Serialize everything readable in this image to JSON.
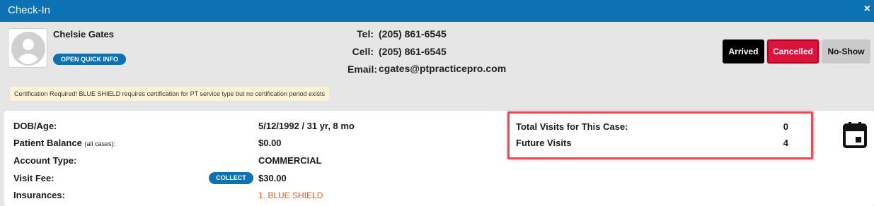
{
  "window": {
    "title": "Check-In",
    "close_glyph": "×"
  },
  "patient": {
    "name": "Chelsie Gates",
    "quick_info_label": "OPEN QUICK INFO",
    "avatar_icon": "user-avatar-icon"
  },
  "contact": {
    "tel_label": "Tel:",
    "tel": "(205) 861-6545",
    "cell_label": "Cell:",
    "cell": "(205) 861-6545",
    "email_label": "Email:",
    "email": "cgates@ptpracticepro.com"
  },
  "status_buttons": {
    "arrived": "Arrived",
    "cancelled": "Cancelled",
    "no_show": "No-Show"
  },
  "certification_notice": "Certification Required! BLUE SHIELD requires certification for PT service type but no certification period exists",
  "details": {
    "dob_label": "DOB/Age:",
    "dob_value": "5/12/1992 / 31 yr, 8 mo",
    "balance_label": "Patient Balance",
    "balance_note": "(all cases):",
    "balance_value": "$0.00",
    "account_type_label": "Account Type:",
    "account_type_value": "COMMERCIAL",
    "visit_fee_label": "Visit Fee:",
    "collect_label": "COLLECT",
    "visit_fee_value": "$30.00",
    "insurances_label": "Insurances:",
    "insurance_1": "1. BLUE SHIELD"
  },
  "visits": {
    "total_label": "Total Visits for This Case:",
    "total_value": "0",
    "future_label": "Future Visits",
    "future_value": "4"
  },
  "icons": {
    "calendar": "calendar-icon",
    "close": "close-icon"
  },
  "colors": {
    "primary": "#0d72b4",
    "cancelled": "#dc143c",
    "highlight": "#e84b55",
    "insurance": "#e0642b"
  }
}
